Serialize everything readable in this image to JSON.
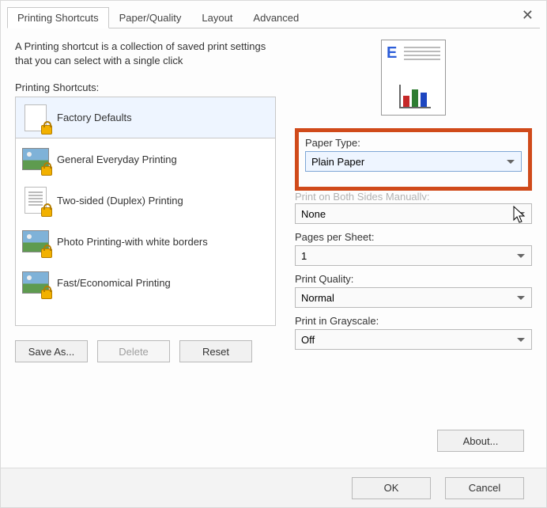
{
  "window": {
    "close_glyph": "✕"
  },
  "tabs": [
    {
      "label": "Printing Shortcuts",
      "active": true
    },
    {
      "label": "Paper/Quality",
      "active": false
    },
    {
      "label": "Layout",
      "active": false
    },
    {
      "label": "Advanced",
      "active": false
    }
  ],
  "intro": "A Printing shortcut is a collection of saved print settings that you can select with a single click",
  "shortcuts": {
    "label": "Printing Shortcuts:",
    "items": [
      {
        "label": "Factory Defaults",
        "icon": "page",
        "selected": true
      },
      {
        "label": "General Everyday Printing",
        "icon": "photo",
        "selected": false
      },
      {
        "label": "Two-sided (Duplex) Printing",
        "icon": "page",
        "selected": false
      },
      {
        "label": "Photo Printing-with white borders",
        "icon": "photo",
        "selected": false
      },
      {
        "label": "Fast/Economical Printing",
        "icon": "photo",
        "selected": false
      }
    ]
  },
  "buttons": {
    "save_as": "Save As...",
    "delete": "Delete",
    "reset": "Reset",
    "about": "About...",
    "ok": "OK",
    "cancel": "Cancel"
  },
  "settings": {
    "paper_type": {
      "label": "Paper Type:",
      "value": "Plain Paper"
    },
    "obscured_label": "Print on Both Sides Manually:",
    "both_sides": {
      "value": "None"
    },
    "pages_per_sheet": {
      "label": "Pages per Sheet:",
      "value": "1"
    },
    "print_quality": {
      "label": "Print Quality:",
      "value": "Normal"
    },
    "grayscale": {
      "label": "Print in Grayscale:",
      "value": "Off"
    }
  },
  "preview": {
    "letter": "E"
  }
}
